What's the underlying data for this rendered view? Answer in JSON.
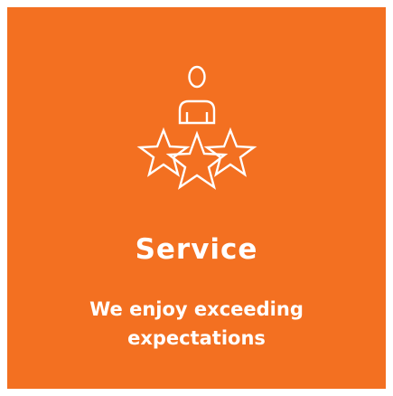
{
  "card": {
    "background_color": "#f37021",
    "text_color": "#ffffff",
    "icon": "person-with-stars-icon",
    "title": "Service",
    "tagline_line1": "We enjoy exceeding",
    "tagline_line2": "expectations"
  }
}
